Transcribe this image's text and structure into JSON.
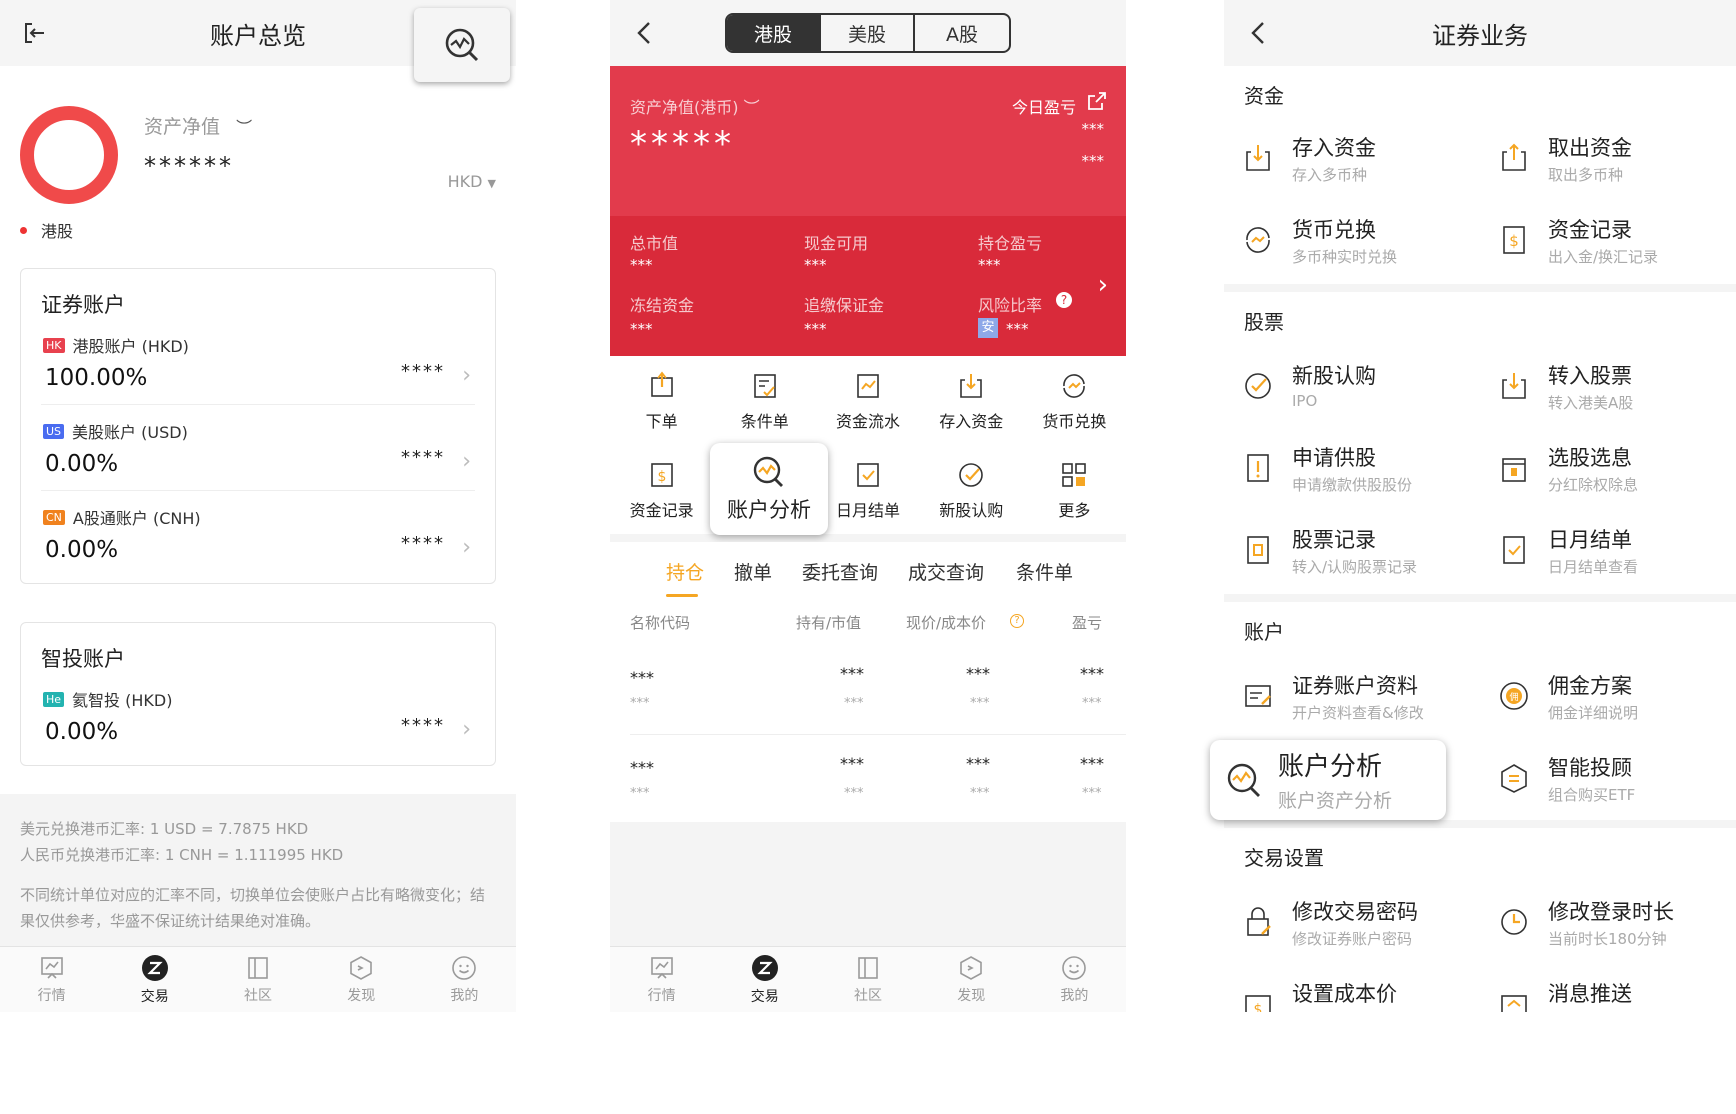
{
  "screen1": {
    "title": "账户总览",
    "net_asset_label": "资产净值",
    "net_asset_value": "******",
    "currency": "HKD",
    "legend_label": "港股",
    "securities_card": {
      "title": "证券账户",
      "accounts": [
        {
          "badge": "HK",
          "name": "港股账户 (HKD)",
          "percent": "100.00%",
          "masked": "****",
          "badge_color": "#e8414e"
        },
        {
          "badge": "US",
          "name": "美股账户 (USD)",
          "percent": "0.00%",
          "masked": "****",
          "badge_color": "#4a6cf0"
        },
        {
          "badge": "CN",
          "name": "A股通账户 (CNH)",
          "percent": "0.00%",
          "masked": "****",
          "badge_color": "#f0821e"
        }
      ]
    },
    "smart_card": {
      "title": "智投账户",
      "accounts": [
        {
          "badge": "He",
          "name": "氦智投 (HKD)",
          "percent": "0.00%",
          "masked": "****",
          "badge_color": "#23b3b0"
        }
      ]
    },
    "rate_usd": "美元兑换港币汇率: 1 USD = 7.7875 HKD",
    "rate_cnh": "人民币兑换港币汇率: 1 CNH = 1.111995 HKD",
    "note": "不同统计单位对应的汇率不同，切换单位会使账户占比有略微变化；结果仅供参考，华盛不保证统计结果绝对准确。"
  },
  "tabbar": [
    "行情",
    "交易",
    "社区",
    "发现",
    "我的"
  ],
  "screen2": {
    "segments": [
      "港股",
      "美股",
      "A股"
    ],
    "net_asset_label": "资产净值(港币)",
    "today_pl_label": "今日盈亏",
    "net_asset_value": "*****",
    "today_pl_value1": "***",
    "today_pl_value2": "***",
    "stats": [
      {
        "label": "总市值",
        "value": "***"
      },
      {
        "label": "现金可用",
        "value": "***"
      },
      {
        "label": "持仓盈亏",
        "value": "***"
      },
      {
        "label": "冻结资金",
        "value": "***"
      },
      {
        "label": "追缴保证金",
        "value": "***"
      },
      {
        "label": "风险比率",
        "value": "***"
      }
    ],
    "risk_badge": "安",
    "grid": [
      "下单",
      "条件单",
      "资金流水",
      "存入资金",
      "货币兑换",
      "资金记录",
      "账户分析",
      "日月结单",
      "新股认购",
      "更多"
    ],
    "tabs": [
      "持仓",
      "撤单",
      "委托查询",
      "成交查询",
      "条件单"
    ],
    "columns": [
      "名称代码",
      "持有/市值",
      "现价/成本价",
      "盈亏"
    ],
    "rows": [
      {
        "main": [
          "***",
          "***",
          "***",
          "***"
        ],
        "sub": [
          "***",
          "***",
          "***",
          "***"
        ]
      },
      {
        "main": [
          "***",
          "***",
          "***",
          "***"
        ],
        "sub": [
          "***",
          "***",
          "***",
          "***"
        ]
      }
    ]
  },
  "screen3": {
    "title": "证券业务",
    "sections": [
      {
        "title": "资金",
        "items": [
          {
            "title": "存入资金",
            "sub": "存入多币种"
          },
          {
            "title": "取出资金",
            "sub": "取出多币种"
          },
          {
            "title": "货币兑换",
            "sub": "多币种实时兑换"
          },
          {
            "title": "资金记录",
            "sub": "出入金/换汇记录"
          }
        ]
      },
      {
        "title": "股票",
        "items": [
          {
            "title": "新股认购",
            "sub": "IPO"
          },
          {
            "title": "转入股票",
            "sub": "转入港美A股"
          },
          {
            "title": "申请供股",
            "sub": "申请缴款供股股份"
          },
          {
            "title": "选股选息",
            "sub": "分红除权除息"
          },
          {
            "title": "股票记录",
            "sub": "转入/认购股票记录"
          },
          {
            "title": "日月结单",
            "sub": "日月结单查看"
          }
        ]
      },
      {
        "title": "账户",
        "items": [
          {
            "title": "证券账户资料",
            "sub": "开户资料查看&修改"
          },
          {
            "title": "佣金方案",
            "sub": "佣金详细说明"
          },
          {
            "title": "账户分析",
            "sub": "账户资产分析"
          },
          {
            "title": "智能投顾",
            "sub": "组合购买ETF"
          }
        ]
      },
      {
        "title": "交易设置",
        "items": [
          {
            "title": "修改交易密码",
            "sub": "修改证券账户密码"
          },
          {
            "title": "修改登录时长",
            "sub": "当前时长180分钟"
          },
          {
            "title": "设置成本价",
            "sub": ""
          },
          {
            "title": "消息推送",
            "sub": ""
          }
        ]
      }
    ]
  },
  "colors": {
    "accent": "#f5a623",
    "red": "#e23b4c",
    "dark_red": "#d92a3a"
  }
}
